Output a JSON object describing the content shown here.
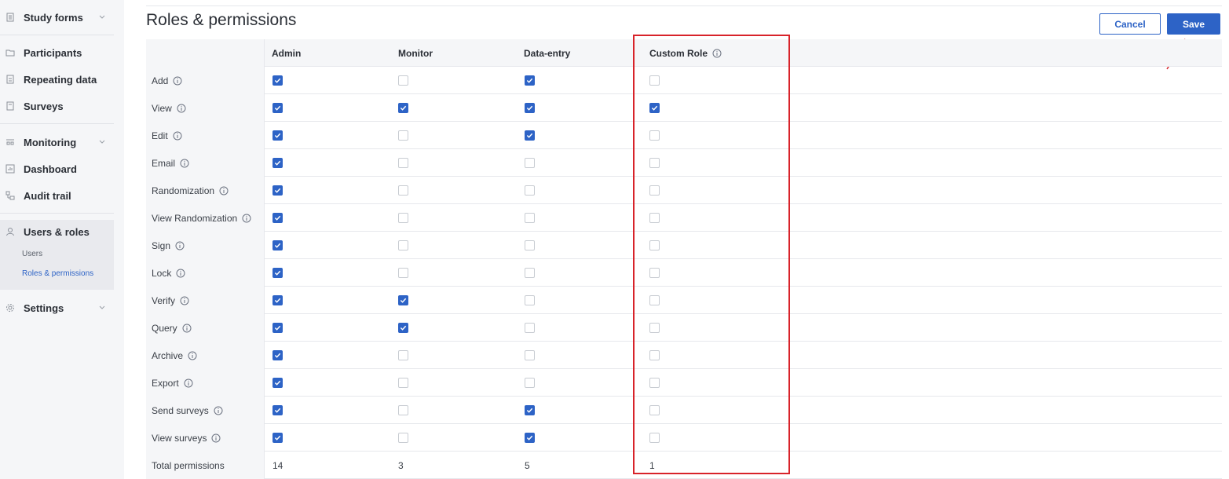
{
  "sidebar": {
    "study_forms": "Study forms",
    "participants": "Participants",
    "repeating_data": "Repeating data",
    "surveys": "Surveys",
    "monitoring": "Monitoring",
    "dashboard": "Dashboard",
    "audit_trail": "Audit trail",
    "users_roles": "Users & roles",
    "users": "Users",
    "roles_permissions": "Roles & permissions",
    "settings": "Settings"
  },
  "header": {
    "title": "Roles & permissions",
    "cancel_label": "Cancel",
    "save_label": "Save"
  },
  "table": {
    "columns": [
      "Admin",
      "Monitor",
      "Data-entry",
      "Custom Role"
    ],
    "rows": [
      {
        "label": "Add",
        "values": [
          true,
          false,
          true,
          false
        ]
      },
      {
        "label": "View",
        "values": [
          true,
          true,
          true,
          true
        ]
      },
      {
        "label": "Edit",
        "values": [
          true,
          false,
          true,
          false
        ]
      },
      {
        "label": "Email",
        "values": [
          true,
          false,
          false,
          false
        ]
      },
      {
        "label": "Randomization",
        "values": [
          true,
          false,
          false,
          false
        ]
      },
      {
        "label": "View Randomization",
        "values": [
          true,
          false,
          false,
          false
        ]
      },
      {
        "label": "Sign",
        "values": [
          true,
          false,
          false,
          false
        ]
      },
      {
        "label": "Lock",
        "values": [
          true,
          false,
          false,
          false
        ]
      },
      {
        "label": "Verify",
        "values": [
          true,
          true,
          false,
          false
        ]
      },
      {
        "label": "Query",
        "values": [
          true,
          true,
          false,
          false
        ]
      },
      {
        "label": "Archive",
        "values": [
          true,
          false,
          false,
          false
        ]
      },
      {
        "label": "Export",
        "values": [
          true,
          false,
          false,
          false
        ]
      },
      {
        "label": "Send surveys",
        "values": [
          true,
          false,
          true,
          false
        ]
      },
      {
        "label": "View surveys",
        "values": [
          true,
          false,
          true,
          false
        ]
      }
    ],
    "total_label": "Total permissions",
    "totals": [
      "14",
      "3",
      "5",
      "1"
    ]
  },
  "colors": {
    "accent": "#2d63c6",
    "highlight": "#d8232a"
  }
}
